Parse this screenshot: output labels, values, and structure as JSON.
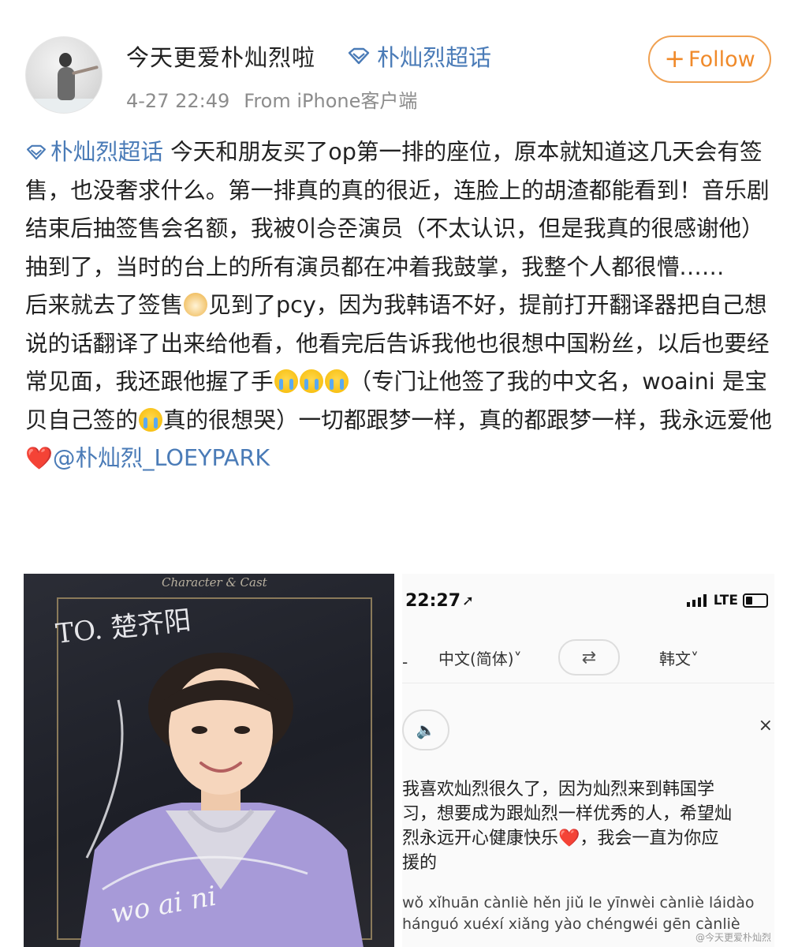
{
  "header": {
    "username": "今天更爱朴灿烈啦",
    "topic": "朴灿烈超话",
    "timestamp": "4-27 22:49",
    "source": "From iPhone客户端",
    "follow_label": "Follow",
    "follow_plus": "+"
  },
  "post": {
    "topic_link": "朴灿烈超话",
    "para1_a": "  今天和朋友买了op第一排的座位，原本就知道这几天会有签售，也没奢求什么。第一排真的真的很近，连脸上的胡渣都能看到！音乐剧结束后抽签售会名额，我被이승준演员（不太认识，但是我真的很感谢他）抽到了，当时的台上的所有演员都在冲着我鼓掌，我整个人都很懵……",
    "para2_a": "后来就去了签售",
    "para2_b": "见到了pcy，因为我韩语不好，提前打开翻译器把自己想说的话翻译了出来给他看，他看完后告诉我他也很想中国粉丝，以后也要经常见面，我还跟他握了手",
    "para2_c": "（专门让他签了我的中文名，woaini 是宝贝自己签的",
    "para2_d": "真的很想哭）一切都跟梦一样，真的都跟梦一样，我永远爱他",
    "heart": "❤️",
    "mention": "@朴灿烈_LOEYPARK"
  },
  "photo_left": {
    "caption": "Character & Cast",
    "signature_top": "TO. 楚齐阳",
    "signature_bottom": "wo ai ni"
  },
  "photo_right": {
    "status_time": "22:27",
    "status_loc": "➚",
    "status_net": "LTE",
    "lang_dash": "-",
    "lang_source": "中文(简体)˅",
    "swap": "⇄",
    "lang_target": "韩文˅",
    "speaker": "🔈",
    "close": "×",
    "translation": "我喜欢灿烈很久了，因为灿烈来到韩国学\n习，想要成为跟灿烈一样优秀的人，希望灿\n烈永远开心健康快乐",
    "translation_tail": "，我会一直为你应\n援的",
    "pinyin": "wǒ xǐhuān cànliè hěn jiǔ le yīnwèi cànliè láidào\nhánguó xuéxí xiǎng yào chéngwéi gēn cànliè",
    "watermark": "@今天更爱朴灿烈"
  },
  "colors": {
    "link": "#4a7bb7",
    "follow": "#f08a2a",
    "meta": "#8c8c8c"
  }
}
